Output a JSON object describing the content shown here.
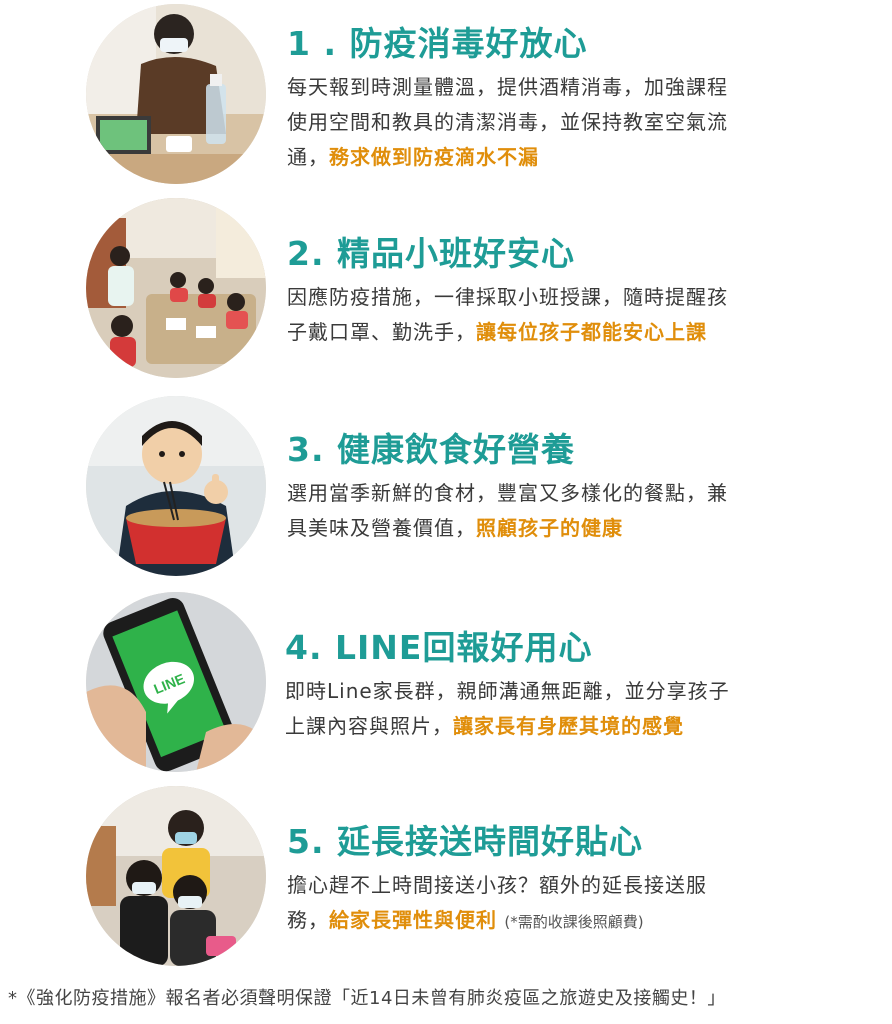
{
  "items": [
    {
      "title": "1 . 防疫消毒好放心",
      "body_lines": [
        "每天報到時測量體溫，提供酒精消毒，加強課程",
        "使用空間和教具的清潔消毒，並保持教室空氣流"
      ],
      "body_tail": "通，",
      "highlight": "務求做到防疫滴水不漏",
      "photo": "photo-temperature-check-disinfection"
    },
    {
      "title": "2. 精品小班好安心",
      "body_lines": [
        "因應防疫措施，一律採取小班授課，隨時提醒孩"
      ],
      "body_tail": "子戴口罩、勤洗手，",
      "highlight": "讓每位孩子都能安心上課",
      "photo": "photo-small-class"
    },
    {
      "title": "3. 健康飲食好營養",
      "body_lines": [
        "選用當季新鮮的食材，豐富又多樣化的餐點，兼"
      ],
      "body_tail": "具美味及營養價值，",
      "highlight": "照顧孩子的健康",
      "photo": "photo-healthy-meal"
    },
    {
      "title": "4. LINE回報好用心",
      "body_lines": [
        "即時Line家長群，親師溝通無距離，並分享孩子"
      ],
      "body_tail": "上課內容與照片，",
      "highlight": "讓家長有身歷其境的感覺",
      "photo": "photo-line-phone",
      "logo_text": "LINE"
    },
    {
      "title": "5. 延長接送時間好貼心",
      "body_lines": [
        "擔心趕不上時間接送小孩？額外的延長接送服"
      ],
      "body_tail": "務，",
      "highlight": "給家長彈性與便利",
      "note": "(*需酌收課後照顧費)",
      "photo": "photo-extended-pickup"
    }
  ],
  "footnote": "*《強化防疫措施》報名者必須聲明保證「近14日未曾有肺炎疫區之旅遊史及接觸史！」",
  "colors": {
    "title": "#1e9c96",
    "highlight": "#e08e0b",
    "body": "#3a3a3a"
  }
}
